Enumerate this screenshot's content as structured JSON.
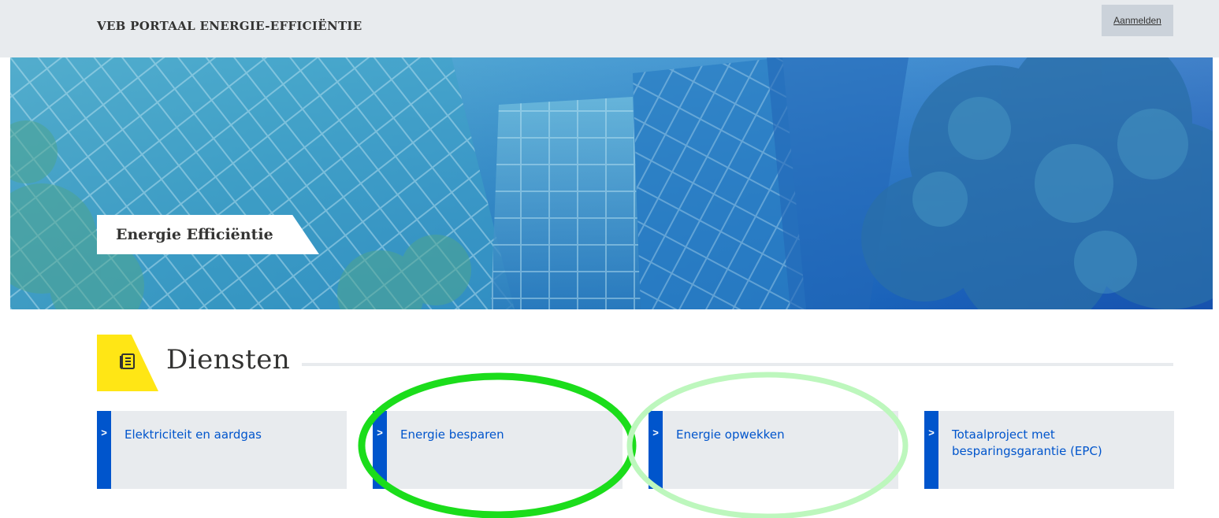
{
  "header": {
    "portal_title": "VEB PORTAAL ENERGIE-EFFICIËNTIE",
    "login_label": "Aanmelden"
  },
  "hero": {
    "label": "Energie Efficiëntie"
  },
  "section": {
    "title": "Diensten",
    "icon": "document-list-icon",
    "badge_color": "#ffe615"
  },
  "cards": [
    {
      "label": "Elektriciteit en aardgas"
    },
    {
      "label": "Energie besparen"
    },
    {
      "label": "Energie opwekken"
    },
    {
      "label": "Totaalproject met besparingsgarantie (EPC)"
    }
  ],
  "colors": {
    "accent": "#0055cc",
    "card_bg": "#e8ebee",
    "annotation_primary": "#1bdd1b",
    "annotation_secondary": "#bdf7bd"
  }
}
